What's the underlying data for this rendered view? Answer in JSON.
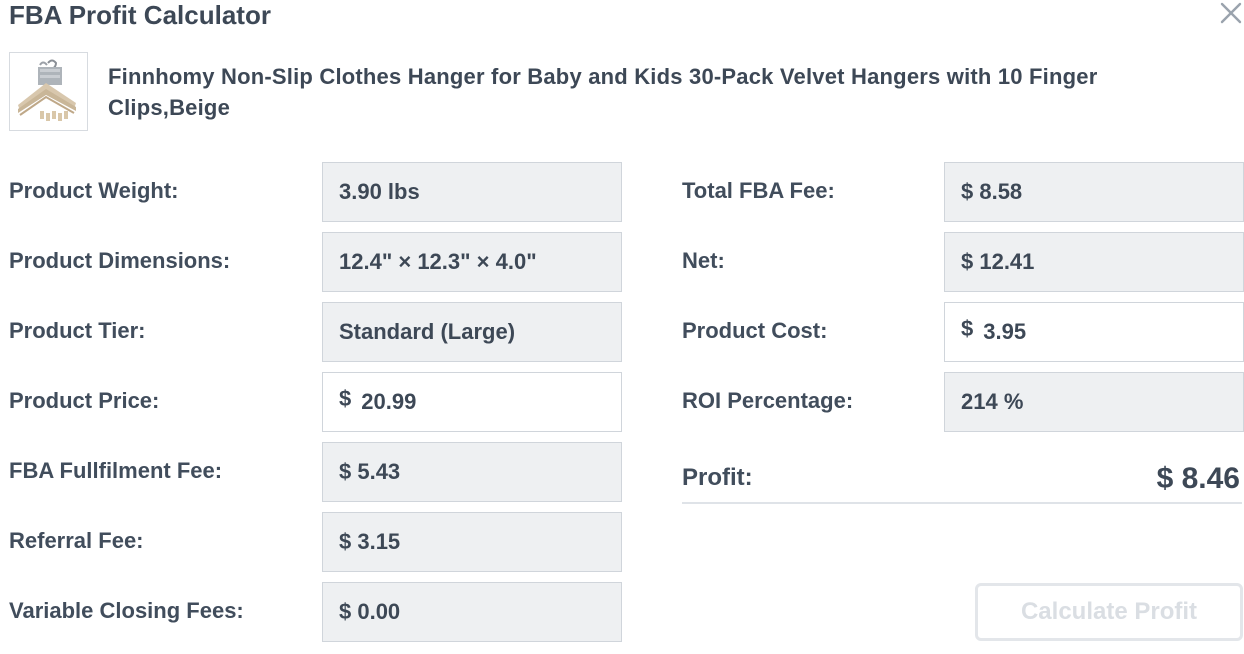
{
  "dialog": {
    "title": "FBA Profit Calculator"
  },
  "product": {
    "title": "Finnhomy Non-Slip Clothes Hanger for Baby and Kids 30-Pack Velvet Hangers with 10 Finger Clips,Beige",
    "thumbnail": "velvet-hangers-thumbnail"
  },
  "left": {
    "weight": {
      "label": "Product Weight:",
      "value": "3.90 lbs"
    },
    "dimensions": {
      "label": "Product Dimensions:",
      "value": "12.4\" × 12.3\" × 4.0\""
    },
    "tier": {
      "label": "Product Tier:",
      "value": "Standard (Large)"
    },
    "price": {
      "label": "Product Price:",
      "currency": "$",
      "value": "20.99"
    },
    "fulfilment": {
      "label": "FBA Fullfilment Fee:",
      "value": "$ 5.43"
    },
    "referral": {
      "label": "Referral Fee:",
      "value": "$ 3.15"
    },
    "closing": {
      "label": "Variable Closing Fees:",
      "value": "$ 0.00"
    }
  },
  "right": {
    "total_fee": {
      "label": "Total FBA Fee:",
      "value": "$ 8.58"
    },
    "net": {
      "label": "Net:",
      "value": "$ 12.41"
    },
    "cost": {
      "label": "Product Cost:",
      "currency": "$",
      "value": "3.95"
    },
    "roi": {
      "label": "ROI Percentage:",
      "value": "214 %"
    },
    "profit": {
      "label": "Profit:",
      "value": "$ 8.46"
    }
  },
  "actions": {
    "calculate_label": "Calculate Profit"
  },
  "colors": {
    "text": "#414d5c",
    "readonly_field_bg": "#eef0f2",
    "field_border": "#d0d5db",
    "disabled_button_text": "#dadee3"
  }
}
